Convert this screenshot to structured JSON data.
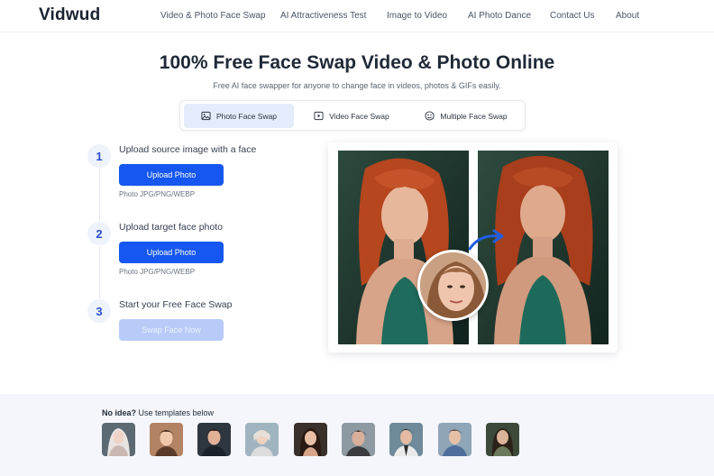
{
  "brand": {
    "name": "Vidwud",
    "accent": "#1557f0"
  },
  "nav": {
    "items": [
      {
        "label": "Video & Photo Face Swap"
      },
      {
        "label": "AI Attractiveness Test"
      },
      {
        "label": "Image to Video"
      },
      {
        "label": "AI Photo Dance"
      },
      {
        "label": "Contact Us"
      },
      {
        "label": "About"
      }
    ]
  },
  "hero": {
    "title": "100% Free Face Swap Video & Photo Online",
    "subtitle": "Free AI face swapper for anyone to change face in videos, photos & GIFs easily."
  },
  "tabs": [
    {
      "label": "Photo Face Swap",
      "icon": "image-icon",
      "active": true
    },
    {
      "label": "Video Face Swap",
      "icon": "video-icon",
      "active": false
    },
    {
      "label": "Multiple Face Swap",
      "icon": "multi-face-icon",
      "active": false
    }
  ],
  "steps": [
    {
      "num": "1",
      "title": "Upload source image with a face",
      "button": "Upload Photo",
      "hint": "Photo JPG/PNG/WEBP"
    },
    {
      "num": "2",
      "title": "Upload target face photo",
      "button": "Upload Photo",
      "hint": "Photo JPG/PNG/WEBP"
    },
    {
      "num": "3",
      "title": "Start your Free Face Swap",
      "button": "Swap Face Now",
      "disabled": true
    }
  ],
  "templates": {
    "label_bold": "No idea?",
    "label_rest": " Use templates below",
    "count": 9
  }
}
